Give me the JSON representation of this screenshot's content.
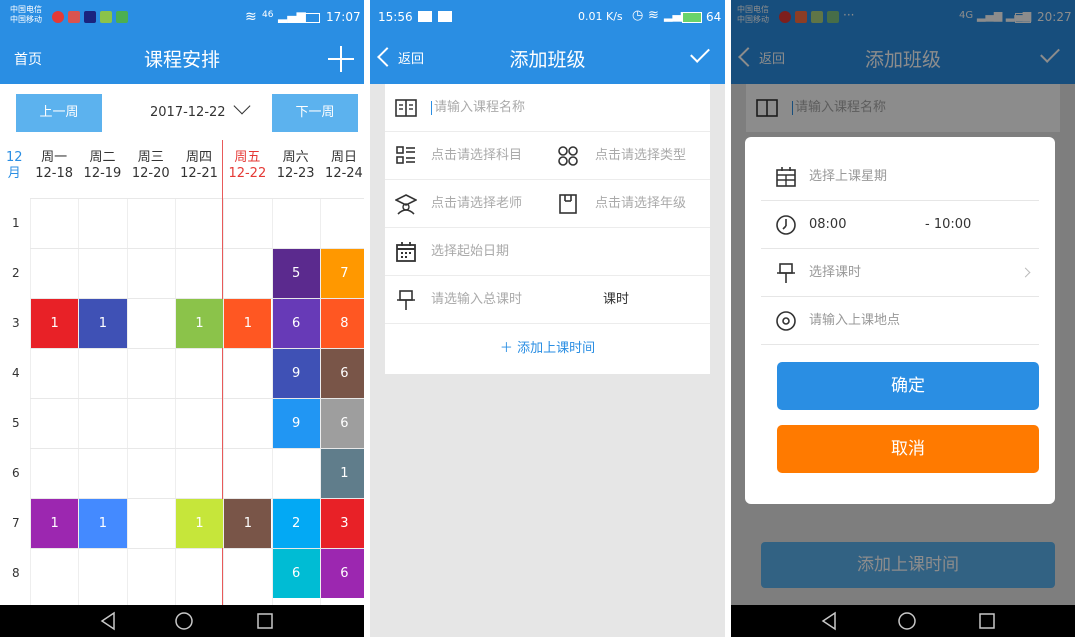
{
  "phone1": {
    "status": {
      "carrier1": "中国电信",
      "carrier2": "中国移动",
      "network": "46",
      "time": "17:07"
    },
    "nav": {
      "home": "首页",
      "title": "课程安排"
    },
    "week": {
      "prev": "上一周",
      "next": "下一周",
      "date": "2017-12-22"
    },
    "month": "12\n月",
    "days": [
      {
        "name": "周一",
        "date": "12-18"
      },
      {
        "name": "周二",
        "date": "12-19"
      },
      {
        "name": "周三",
        "date": "12-20"
      },
      {
        "name": "周四",
        "date": "12-21"
      },
      {
        "name": "周五",
        "date": "12-22"
      },
      {
        "name": "周六",
        "date": "12-23"
      },
      {
        "name": "周日",
        "date": "12-24"
      }
    ],
    "rows": [
      "1",
      "2",
      "3",
      "4",
      "5",
      "6",
      "7",
      "8"
    ],
    "cells": [
      {
        "row": 2,
        "col": 6,
        "label": "5",
        "color": "#5b2a8e"
      },
      {
        "row": 2,
        "col": 7,
        "label": "7",
        "color": "#ff9800"
      },
      {
        "row": 3,
        "col": 1,
        "label": "1",
        "color": "#e82127"
      },
      {
        "row": 3,
        "col": 2,
        "label": "1",
        "color": "#3f51b5"
      },
      {
        "row": 3,
        "col": 4,
        "label": "1",
        "color": "#8bc34a"
      },
      {
        "row": 3,
        "col": 5,
        "label": "1",
        "color": "#ff5722"
      },
      {
        "row": 3,
        "col": 6,
        "label": "6",
        "color": "#673ab7"
      },
      {
        "row": 3,
        "col": 7,
        "label": "8",
        "color": "#ff5722"
      },
      {
        "row": 4,
        "col": 6,
        "label": "9",
        "color": "#3f51b5"
      },
      {
        "row": 4,
        "col": 7,
        "label": "6",
        "color": "#795548"
      },
      {
        "row": 5,
        "col": 6,
        "label": "9",
        "color": "#2196f3"
      },
      {
        "row": 5,
        "col": 7,
        "label": "6",
        "color": "#9e9e9e"
      },
      {
        "row": 6,
        "col": 7,
        "label": "1",
        "color": "#607d8b"
      },
      {
        "row": 7,
        "col": 1,
        "label": "1",
        "color": "#9c27b0"
      },
      {
        "row": 7,
        "col": 2,
        "label": "1",
        "color": "#448aff"
      },
      {
        "row": 7,
        "col": 4,
        "label": "1",
        "color": "#c6e63a"
      },
      {
        "row": 7,
        "col": 5,
        "label": "1",
        "color": "#795548"
      },
      {
        "row": 7,
        "col": 6,
        "label": "2",
        "color": "#03a9f4"
      },
      {
        "row": 7,
        "col": 7,
        "label": "3",
        "color": "#e82127"
      },
      {
        "row": 8,
        "col": 6,
        "label": "6",
        "color": "#00bcd4"
      },
      {
        "row": 8,
        "col": 7,
        "label": "6",
        "color": "#9c27b0"
      }
    ]
  },
  "phone2": {
    "status": {
      "time": "15:56",
      "speed": "0.01 K/s",
      "battery": "64"
    },
    "nav": {
      "back": "返回",
      "title": "添加班级"
    },
    "form": {
      "course_placeholder": "请输入课程名称",
      "subject": "点击请选择科目",
      "type": "点击请选择类型",
      "teacher": "点击请选择老师",
      "grade": "点击请选择年级",
      "start_date": "选择起始日期",
      "total_hours": "请选输入总课时",
      "hours_unit": "课时",
      "add_time": "添加上课时间"
    }
  },
  "phone3": {
    "status": {
      "carrier1": "中国电信",
      "carrier2": "中国移动",
      "network": "4G",
      "time": "20:27"
    },
    "nav": {
      "back": "返回",
      "title": "添加班级"
    },
    "bg": {
      "course_placeholder": "请输入课程名称",
      "add_time": "添加上课时间"
    },
    "dialog": {
      "weekday": "选择上课星期",
      "start_time": "08:00",
      "end_time": "- 10:00",
      "hours": "选择课时",
      "location": "请输入上课地点",
      "confirm": "确定",
      "cancel": "取消",
      "confirm_color": "#2a8ee3",
      "cancel_color": "#ff7a00"
    }
  }
}
